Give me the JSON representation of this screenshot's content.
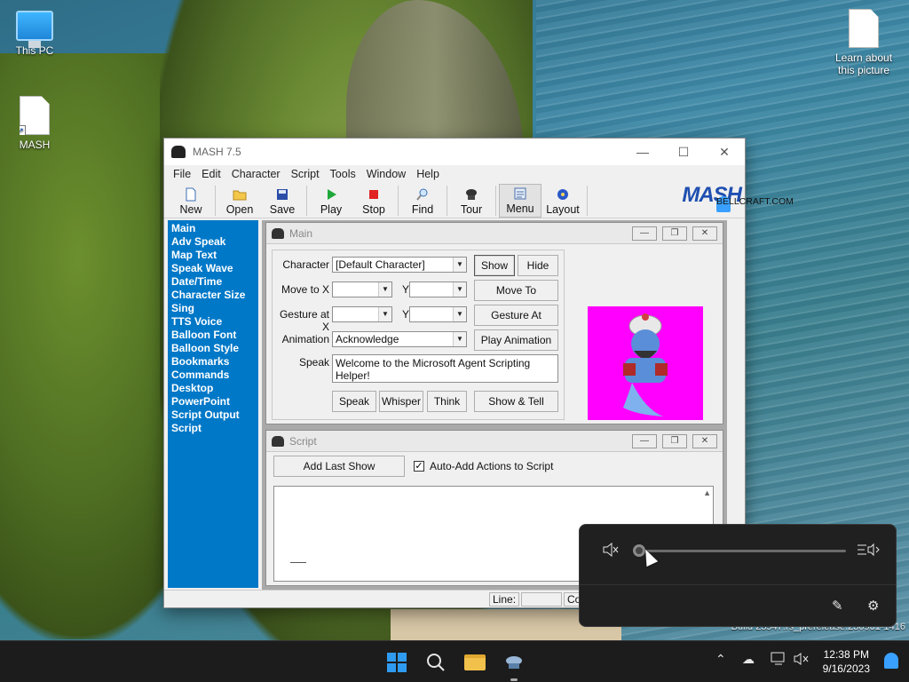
{
  "desktop": {
    "icons": [
      {
        "label": "This PC"
      },
      {
        "label": "MASH"
      },
      {
        "label": "Learn about this picture"
      }
    ],
    "watermark": "Build 23547.rs_prerelease.230901-1416"
  },
  "window": {
    "title": "MASH 7.5",
    "menu": [
      "File",
      "Edit",
      "Character",
      "Script",
      "Tools",
      "Window",
      "Help"
    ],
    "toolbar": [
      {
        "label": "New",
        "icon": "new-doc-icon"
      },
      {
        "label": "Open",
        "icon": "open-folder-icon"
      },
      {
        "label": "Save",
        "icon": "save-disk-icon"
      },
      {
        "label": "Play",
        "icon": "play-icon"
      },
      {
        "label": "Stop",
        "icon": "stop-icon"
      },
      {
        "label": "Find",
        "icon": "find-icon"
      },
      {
        "label": "Tour",
        "icon": "genie-icon"
      },
      {
        "label": "Menu",
        "icon": "menu-icon"
      },
      {
        "label": "Layout",
        "icon": "layout-icon"
      }
    ],
    "logo": {
      "name": "MASH",
      "site": "BELLCRAFT.COM"
    },
    "sidebar": [
      "Main",
      "Adv Speak",
      "Map Text",
      "Speak Wave",
      "Date/Time",
      "Character Size",
      "Sing",
      "TTS Voice",
      "Balloon Font",
      "Balloon Style",
      "Bookmarks",
      "Commands",
      "Desktop",
      "PowerPoint",
      "Script Output",
      "Script"
    ],
    "main_child": {
      "title": "Main",
      "character_label": "Character",
      "character_value": "[Default Character]",
      "show": "Show",
      "hide": "Hide",
      "move_to_x": "Move to X",
      "y": "Y",
      "move_to_btn": "Move To",
      "gesture_at_x": "Gesture at X",
      "gesture_at_btn": "Gesture At",
      "animation_label": "Animation",
      "animation_value": "Acknowledge",
      "play_animation": "Play Animation",
      "speak_label": "Speak",
      "speak_text": "Welcome to the Microsoft Agent Scripting Helper!",
      "speak_btn": "Speak",
      "whisper_btn": "Whisper",
      "think_btn": "Think",
      "show_tell_btn": "Show & Tell"
    },
    "script_child": {
      "title": "Script",
      "add_last_show": "Add Last Show",
      "auto_add_label": "Auto-Add Actions to Script",
      "auto_add_checked": true
    },
    "status": {
      "line_label": "Line:",
      "col_label": "Co"
    }
  },
  "volume_flyout": {
    "level": 0,
    "muted": true
  },
  "taskbar": {
    "time": "12:38 PM",
    "date": "9/16/2023"
  },
  "colors": {
    "sidebar": "#0078c8",
    "genie_bg": "#ff00ff",
    "accent": "#2f9bf0"
  }
}
